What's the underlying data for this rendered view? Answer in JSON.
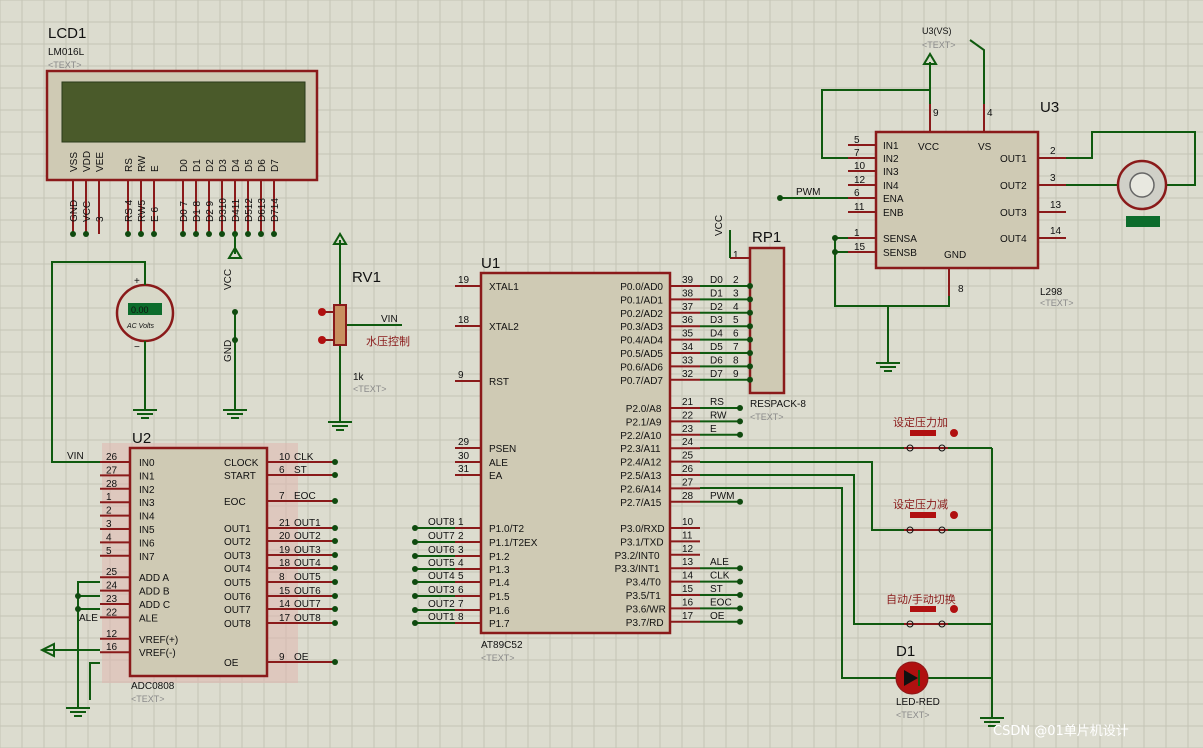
{
  "lcd": {
    "ref": "LCD1",
    "part": "LM016L",
    "tag": "<TEXT>",
    "pins": [
      "VSS",
      "VDD",
      "VEE",
      "RS",
      "RW",
      "E",
      "D0",
      "D1",
      "D2",
      "D3",
      "D4",
      "D5",
      "D6",
      "D7"
    ],
    "nets": [
      "GND",
      "VCC",
      "3",
      "RS 4",
      "RW5",
      "E 6",
      "D0 7",
      "D1 8",
      "D2 9",
      "D310",
      "D411",
      "D512",
      "D613",
      "D714"
    ]
  },
  "rp1": {
    "ref": "RP1",
    "part": "RESPACK-8",
    "tag": "<TEXT>",
    "pin1": "1",
    "vcc": "VCC",
    "pins": [
      "2",
      "3",
      "4",
      "5",
      "6",
      "7",
      "8",
      "9"
    ]
  },
  "rv1": {
    "ref": "RV1",
    "value": "1k",
    "tag": "<TEXT>",
    "net": "VIN",
    "label": "水压控制"
  },
  "u1": {
    "ref": "U1",
    "part": "AT89C52",
    "tag": "<TEXT>",
    "left": [
      [
        "19",
        "XTAL1"
      ],
      [
        "18",
        "XTAL2"
      ],
      [
        "9",
        "RST"
      ],
      [
        "29",
        "PSEN"
      ],
      [
        "30",
        "ALE"
      ],
      [
        "31",
        "EA"
      ],
      [
        "1",
        "P1.0/T2"
      ],
      [
        "2",
        "P1.1/T2EX"
      ],
      [
        "3",
        "P1.2"
      ],
      [
        "4",
        "P1.3"
      ],
      [
        "5",
        "P1.4"
      ],
      [
        "6",
        "P1.5"
      ],
      [
        "7",
        "P1.6"
      ],
      [
        "8",
        "P1.7"
      ]
    ],
    "p0": [
      [
        "39",
        "P0.0/AD0",
        "D0"
      ],
      [
        "38",
        "P0.1/AD1",
        "D1"
      ],
      [
        "37",
        "P0.2/AD2",
        "D2"
      ],
      [
        "36",
        "P0.3/AD3",
        "D3"
      ],
      [
        "35",
        "P0.4/AD4",
        "D4"
      ],
      [
        "34",
        "P0.5/AD5",
        "D5"
      ],
      [
        "33",
        "P0.6/AD6",
        "D6"
      ],
      [
        "32",
        "P0.7/AD7",
        "D7"
      ]
    ],
    "p2": [
      [
        "21",
        "P2.0/A8",
        "RS"
      ],
      [
        "22",
        "P2.1/A9",
        "RW"
      ],
      [
        "23",
        "P2.2/A10",
        "E"
      ],
      [
        "24",
        "P2.3/A11",
        ""
      ],
      [
        "25",
        "P2.4/A12",
        ""
      ],
      [
        "26",
        "P2.5/A13",
        ""
      ],
      [
        "27",
        "P2.6/A14",
        ""
      ],
      [
        "28",
        "P2.7/A15",
        "PWM"
      ]
    ],
    "p3": [
      [
        "10",
        "P3.0/RXD",
        ""
      ],
      [
        "11",
        "P3.1/TXD",
        ""
      ],
      [
        "12",
        "P3.2/INT0",
        ""
      ],
      [
        "13",
        "P3.3/INT1",
        "ALE"
      ],
      [
        "14",
        "P3.4/T0",
        "CLK"
      ],
      [
        "15",
        "P3.5/T1",
        "ST"
      ],
      [
        "16",
        "P3.6/WR",
        "EOC"
      ],
      [
        "17",
        "P3.7/RD",
        "OE"
      ]
    ],
    "p1nets": [
      "OUT8",
      "OUT7",
      "OUT6",
      "OUT5",
      "OUT4",
      "OUT3",
      "OUT2",
      "OUT1"
    ]
  },
  "u2": {
    "ref": "U2",
    "part": "ADC0808",
    "tag": "<TEXT>",
    "left": [
      [
        "26",
        "IN0"
      ],
      [
        "27",
        "IN1"
      ],
      [
        "28",
        "IN2"
      ],
      [
        "1",
        "IN3"
      ],
      [
        "2",
        "IN4"
      ],
      [
        "3",
        "IN5"
      ],
      [
        "4",
        "IN6"
      ],
      [
        "5",
        "IN7"
      ],
      [
        "25",
        "ADD A"
      ],
      [
        "24",
        "ADD B"
      ],
      [
        "23",
        "ADD C"
      ],
      [
        "22",
        "ALE"
      ],
      [
        "12",
        "VREF(+)"
      ],
      [
        "16",
        "VREF(-)"
      ]
    ],
    "right": [
      [
        "10",
        "CLOCK",
        "CLK"
      ],
      [
        "6",
        "START",
        "ST"
      ],
      [
        "7",
        "EOC",
        "EOC"
      ],
      [
        "21",
        "OUT1",
        "OUT1"
      ],
      [
        "20",
        "OUT2",
        "OUT2"
      ],
      [
        "19",
        "OUT3",
        "OUT3"
      ],
      [
        "18",
        "OUT4",
        "OUT4"
      ],
      [
        "8",
        "OUT5",
        "OUT5"
      ],
      [
        "15",
        "OUT6",
        "OUT6"
      ],
      [
        "14",
        "OUT7",
        "OUT7"
      ],
      [
        "17",
        "OUT8",
        "OUT8"
      ],
      [
        "9",
        "OE",
        "OE"
      ]
    ],
    "vin": "VIN",
    "ale": "ALE"
  },
  "u3": {
    "ref": "U3",
    "part": "L298",
    "tag": "<TEXT>",
    "left": [
      [
        "5",
        "IN1"
      ],
      [
        "7",
        "IN2"
      ],
      [
        "10",
        "IN3"
      ],
      [
        "12",
        "IN4"
      ],
      [
        "6",
        "ENA"
      ],
      [
        "11",
        "ENB"
      ],
      [
        "1",
        "SENSA"
      ],
      [
        "15",
        "SENSB"
      ]
    ],
    "top": [
      [
        "9",
        "VCC"
      ],
      [
        "4",
        "VS"
      ]
    ],
    "right": [
      [
        "2",
        "OUT1"
      ],
      [
        "3",
        "OUT2"
      ],
      [
        "13",
        "OUT3"
      ],
      [
        "14",
        "OUT4"
      ]
    ],
    "gnd": [
      "8",
      "GND"
    ],
    "pwm": "PWM",
    "vs": "U3(VS)",
    "vstag": "<TEXT>"
  },
  "meter": {
    "unit": "AC Volts",
    "reading": "0.00",
    "plus": "+",
    "minus": "−"
  },
  "buttons": [
    {
      "label": "设定压力加"
    },
    {
      "label": "设定压力减"
    },
    {
      "label": "自动/手动切换"
    }
  ],
  "d1": {
    "ref": "D1",
    "part": "LED-RED",
    "tag": "<TEXT>"
  },
  "power": {
    "vcc": "VCC",
    "gnd": "GND"
  },
  "watermark": "CSDN @01单片机设计"
}
